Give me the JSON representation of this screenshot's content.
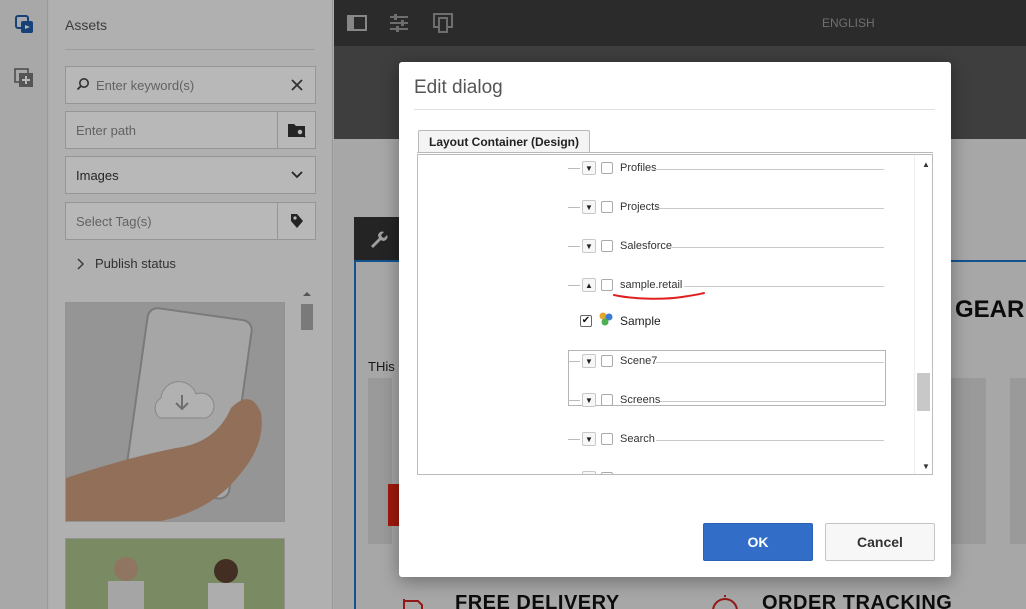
{
  "rail": {
    "icons": [
      "assets-icon",
      "add-component-icon"
    ]
  },
  "assets": {
    "title": "Assets",
    "search": {
      "placeholder": "Enter keyword(s)"
    },
    "path": {
      "placeholder": "Enter path"
    },
    "type": {
      "value": "Images"
    },
    "tags": {
      "placeholder": "Select Tag(s)"
    },
    "publish_status": "Publish status"
  },
  "topbar": {
    "language": "ENGLISH"
  },
  "page": {
    "heading_fragment": "GEAR",
    "text_fragment": "THis",
    "footer_left": "FREE DELIVERY",
    "footer_right": "ORDER TRACKING"
  },
  "dialog": {
    "title": "Edit dialog",
    "tab": "Layout Container (Design)",
    "tree": {
      "items": [
        {
          "label": "Profiles",
          "expanded": false,
          "checked": false
        },
        {
          "label": "Projects",
          "expanded": false,
          "checked": false
        },
        {
          "label": "Salesforce",
          "expanded": false,
          "checked": false
        },
        {
          "label": "sample.retail",
          "expanded": true,
          "checked": false
        },
        {
          "label": "Scene7",
          "expanded": false,
          "checked": false
        },
        {
          "label": "Screens",
          "expanded": false,
          "checked": false
        },
        {
          "label": "Search",
          "expanded": false,
          "checked": false
        }
      ],
      "child": {
        "label": "Sample",
        "checked": true
      }
    },
    "ok_label": "OK",
    "cancel_label": "Cancel"
  },
  "colors": {
    "primary": "#326ec8",
    "annotation": "#e02020",
    "selection_border": "#1a73c8"
  }
}
